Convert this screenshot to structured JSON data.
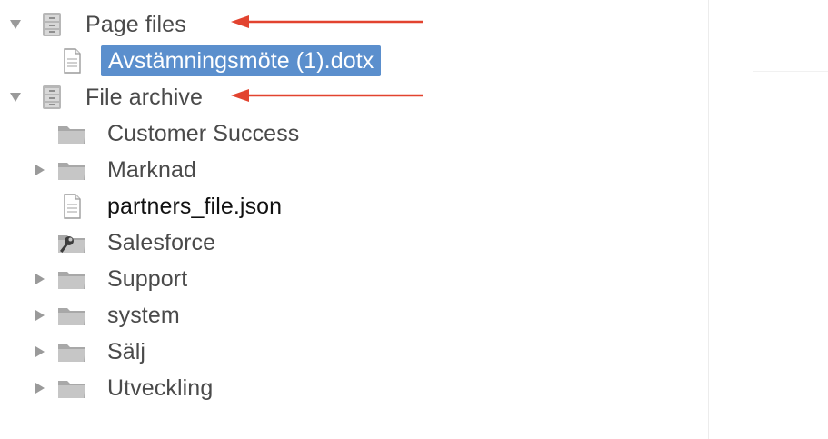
{
  "tree": {
    "page_files": {
      "label": "Page files",
      "expanded": true,
      "icon": "cabinet-icon",
      "children": [
        {
          "label": "Avstämningsmöte (1).dotx",
          "icon": "document-icon",
          "selected": true
        }
      ]
    },
    "file_archive": {
      "label": "File archive",
      "expanded": true,
      "icon": "cabinet-icon",
      "children": [
        {
          "label": "Customer Success",
          "icon": "folder-icon",
          "expandable": false
        },
        {
          "label": "Marknad",
          "icon": "folder-icon",
          "expandable": true
        },
        {
          "label": "partners_file.json",
          "icon": "document-icon",
          "expandable": false
        },
        {
          "label": "Salesforce",
          "icon": "wrench-folder-icon",
          "expandable": false
        },
        {
          "label": "Support",
          "icon": "folder-icon",
          "expandable": true
        },
        {
          "label": "system",
          "icon": "folder-icon",
          "expandable": true
        },
        {
          "label": "Sälj",
          "icon": "folder-icon",
          "expandable": true
        },
        {
          "label": "Utveckling",
          "icon": "folder-icon",
          "expandable": true
        }
      ]
    }
  },
  "colors": {
    "selection": "#5b8fcd",
    "annotation_arrow": "#e2432f",
    "toggle": "#9a9a9a",
    "icon_gray": "#a9a9a9"
  }
}
